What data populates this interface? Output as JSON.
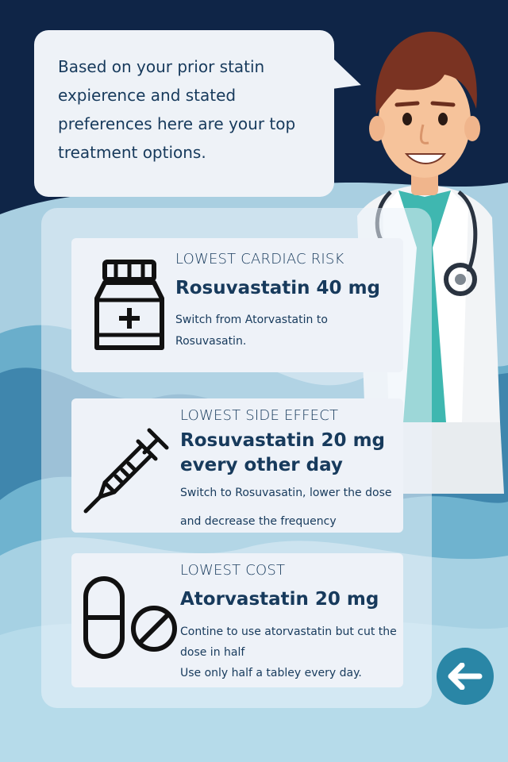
{
  "bubble": {
    "text": "Based on your prior statin expierence and stated preferences here are your top treatment options."
  },
  "options": [
    {
      "label": "LOWEST CARDIAC RISK",
      "title": "Rosuvastatin 40 mg",
      "desc_lines": [
        "Switch from Atorvastatin to",
        "Rosuvasatin."
      ],
      "icon": "medicine-bottle-icon"
    },
    {
      "label": "LOWEST SIDE EFFECT",
      "title_lines": [
        "Rosuvastatin 20 mg",
        "every other day"
      ],
      "desc_lines": [
        "Switch to  Rosuvasatin, lower the dose",
        "and decrease the frequency"
      ],
      "icon": "syringe-icon"
    },
    {
      "label": "LOWEST COST",
      "title": "Atorvastatin 20 mg",
      "desc_lines": [
        "Contine to use atorvastatin but cut the",
        "dose in half",
        "Use only half a tabley every day."
      ],
      "icon": "pill-capsule-icon"
    }
  ],
  "back_button": {
    "icon": "arrow-left-icon"
  },
  "colors": {
    "navy": "#0f2547",
    "text": "#173a5c",
    "accent": "#2a86a6"
  }
}
